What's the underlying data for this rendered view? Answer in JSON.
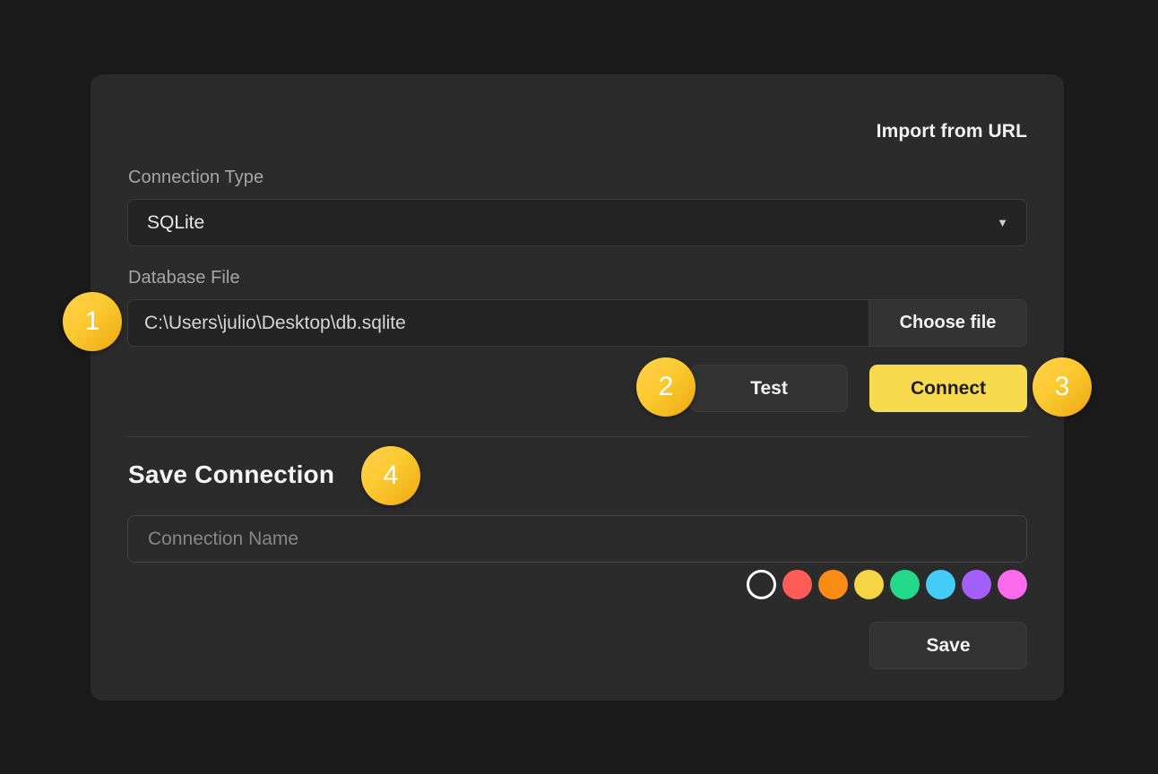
{
  "theme": {
    "page_background": "#1a1a1a",
    "panel_background": "#2b2b2b",
    "accent": "#f7da4e",
    "badge_gradient_from": "#ffd24d",
    "badge_gradient_to": "#eda70f"
  },
  "panel": {
    "import_from_url_label": "Import from URL",
    "connection_type": {
      "label": "Connection Type",
      "value": "SQLite",
      "chevron_icon": "chevron-down-icon",
      "chevron_glyph": "▼"
    },
    "database_file": {
      "label": "Database File",
      "value": "C:\\Users\\julio\\Desktop\\db.sqlite",
      "placeholder": "Database file path",
      "choose_file_label": "Choose file"
    },
    "actions": {
      "test_label": "Test",
      "connect_label": "Connect"
    },
    "save_connection": {
      "heading": "Save Connection",
      "name_input": {
        "value": "",
        "placeholder": "Connection Name"
      },
      "colors": [
        {
          "name": "none",
          "hex": "transparent",
          "selected": true
        },
        {
          "name": "red",
          "hex": "#ff5c57",
          "selected": false
        },
        {
          "name": "orange",
          "hex": "#fa8c16",
          "selected": false
        },
        {
          "name": "yellow",
          "hex": "#f7d443",
          "selected": false
        },
        {
          "name": "green",
          "hex": "#24d989",
          "selected": false
        },
        {
          "name": "blue",
          "hex": "#44cdf8",
          "selected": false
        },
        {
          "name": "purple",
          "hex": "#a45efa",
          "selected": false
        },
        {
          "name": "pink",
          "hex": "#fc6bee",
          "selected": false
        }
      ],
      "save_label": "Save"
    }
  },
  "step_badges": [
    {
      "number": "1"
    },
    {
      "number": "2"
    },
    {
      "number": "3"
    },
    {
      "number": "4"
    }
  ]
}
